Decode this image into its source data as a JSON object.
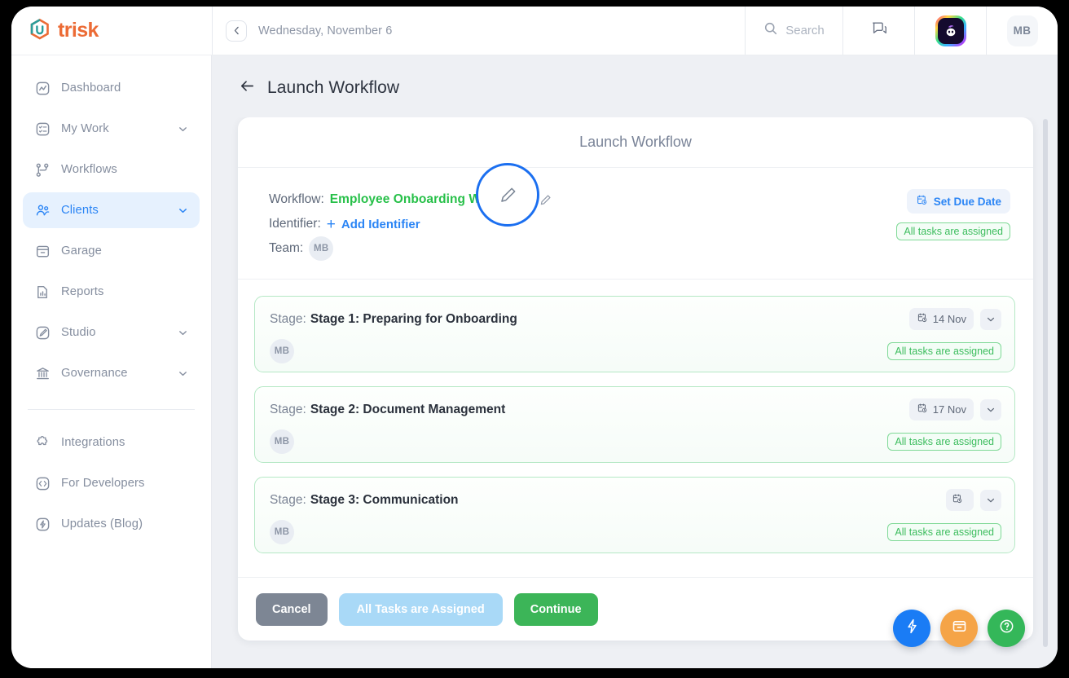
{
  "brand": {
    "name": "trisk"
  },
  "topbar": {
    "back_icon": "chevron-left-icon",
    "date": "Wednesday, November 6",
    "search_label": "Search",
    "search_icon": "search-icon",
    "chat_icon": "chat-bubbles-icon",
    "bot_icon": "ai-bot-avatar",
    "user_initials": "MB"
  },
  "sidebar": {
    "items": [
      {
        "label": "Dashboard",
        "icon": "dashboard-icon",
        "caret": false,
        "active": false
      },
      {
        "label": "My Work",
        "icon": "checklist-icon",
        "caret": true,
        "active": false
      },
      {
        "label": "Workflows",
        "icon": "workflow-icon",
        "caret": false,
        "active": false
      },
      {
        "label": "Clients",
        "icon": "people-icon",
        "caret": true,
        "active": true
      },
      {
        "label": "Garage",
        "icon": "garage-box-icon",
        "caret": false,
        "active": false
      },
      {
        "label": "Reports",
        "icon": "report-chart-icon",
        "caret": false,
        "active": false
      },
      {
        "label": "Studio",
        "icon": "studio-brush-icon",
        "caret": true,
        "active": false
      },
      {
        "label": "Governance",
        "icon": "bank-icon",
        "caret": true,
        "active": false
      }
    ],
    "secondary_items": [
      {
        "label": "Integrations",
        "icon": "puzzle-icon"
      },
      {
        "label": "For Developers",
        "icon": "code-icon"
      },
      {
        "label": "Updates (Blog)",
        "icon": "bolt-circle-icon"
      }
    ]
  },
  "page": {
    "back_icon": "arrow-left-icon",
    "title": "Launch Workflow"
  },
  "panel": {
    "title": "Launch Workflow",
    "workflow": {
      "workflow_label": "Workflow:",
      "workflow_name": "Employee Onboarding Workflow",
      "edit_icon": "pencil-icon",
      "identifier_label": "Identifier:",
      "add_identifier": "Add Identifier",
      "team_label": "Team:",
      "team_initials": "MB",
      "set_due_date": "Set Due Date",
      "due_date_icon": "calendar-clock-icon",
      "assigned_badge": "All tasks are assigned"
    },
    "stages": [
      {
        "label": "Stage:",
        "name": "Stage 1: Preparing for Onboarding",
        "date": "14 Nov",
        "date_icon": "calendar-clock-icon",
        "caret_icon": "chevron-down-icon",
        "assignee": "MB",
        "badge": "All tasks are assigned"
      },
      {
        "label": "Stage:",
        "name": "Stage 2: Document Management",
        "date": "17 Nov",
        "date_icon": "calendar-clock-icon",
        "caret_icon": "chevron-down-icon",
        "assignee": "MB",
        "badge": "All tasks are assigned"
      },
      {
        "label": "Stage:",
        "name": "Stage 3: Communication",
        "date": "",
        "date_icon": "calendar-clock-icon",
        "caret_icon": "chevron-down-icon",
        "assignee": "MB",
        "badge": "All tasks are assigned"
      }
    ],
    "footer": {
      "cancel": "Cancel",
      "assigned": "All Tasks are Assigned",
      "continue": "Continue"
    }
  },
  "fabs": [
    {
      "name": "quick-action-bolt",
      "icon": "bolt-icon",
      "color": "#1a7cf5"
    },
    {
      "name": "archive",
      "icon": "archive-icon",
      "color": "#f5a447"
    },
    {
      "name": "help",
      "icon": "help-icon",
      "color": "#34b759"
    }
  ],
  "colors": {
    "brand_orange": "#ec6b35",
    "brand_teal": "#2a9d9b",
    "accent_blue": "#2b85f5",
    "success_green": "#3cb558",
    "workflow_green": "#27c049",
    "highlight_ring": "#1b6ff0"
  }
}
